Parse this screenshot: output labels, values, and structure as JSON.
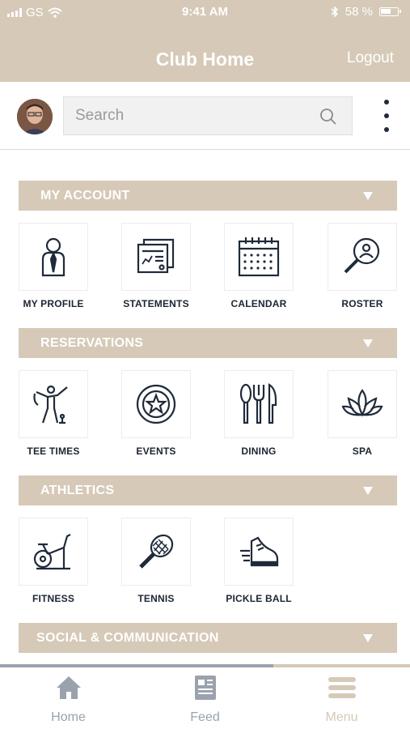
{
  "status_bar": {
    "carrier": "GS",
    "time": "9:41 AM",
    "battery": "58 %"
  },
  "header": {
    "title": "Club Home",
    "logout_label": "Logout"
  },
  "search": {
    "placeholder": "Search"
  },
  "sections": [
    {
      "title": "MY ACCOUNT",
      "items": [
        {
          "label": "MY PROFILE",
          "icon": "profile-icon"
        },
        {
          "label": "STATEMENTS",
          "icon": "statements-icon"
        },
        {
          "label": "CALENDAR",
          "icon": "calendar-icon"
        },
        {
          "label": "ROSTER",
          "icon": "roster-search-icon"
        }
      ]
    },
    {
      "title": "RESERVATIONS",
      "items": [
        {
          "label": "TEE TIMES",
          "icon": "golfer-icon"
        },
        {
          "label": "EVENTS",
          "icon": "star-badge-icon"
        },
        {
          "label": "DINING",
          "icon": "dining-utensils-icon"
        },
        {
          "label": "SPA",
          "icon": "lotus-icon"
        }
      ]
    },
    {
      "title": "ATHLETICS",
      "items": [
        {
          "label": "FITNESS",
          "icon": "exercise-bike-icon"
        },
        {
          "label": "TENNIS",
          "icon": "tennis-racket-icon"
        },
        {
          "label": "PICKLE BALL",
          "icon": "sneaker-icon"
        }
      ]
    },
    {
      "title": "SOCIAL & COMMUNICATION",
      "items": []
    }
  ],
  "tabs": [
    {
      "label": "Home",
      "icon": "home-icon"
    },
    {
      "label": "Feed",
      "icon": "feed-icon"
    },
    {
      "label": "Menu",
      "icon": "menu-icon"
    }
  ],
  "colors": {
    "brand_tan": "#d6c9b7",
    "icon_navy": "#1f2a3a",
    "tab_inactive": "#9aa2ad"
  }
}
